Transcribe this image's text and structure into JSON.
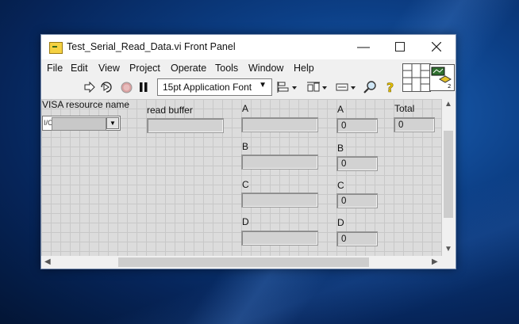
{
  "window": {
    "title": "Test_Serial_Read_Data.vi Front Panel",
    "minimize_glyph": "—",
    "maximize_glyph": "☐",
    "close_glyph": "✕"
  },
  "menu": [
    "File",
    "Edit",
    "View",
    "Project",
    "Operate",
    "Tools",
    "Window",
    "Help"
  ],
  "toolbar": {
    "font_selector": "15pt Application Font"
  },
  "panel": {
    "visa_label": "VISA resource name",
    "visa_value": "",
    "read_buffer_label": "read buffer",
    "read_buffer_value": "",
    "string_indicators": [
      {
        "label": "A",
        "value": ""
      },
      {
        "label": "B",
        "value": ""
      },
      {
        "label": "C",
        "value": ""
      },
      {
        "label": "D",
        "value": ""
      }
    ],
    "numeric_indicators": [
      {
        "label": "A",
        "value": "0"
      },
      {
        "label": "B",
        "value": "0"
      },
      {
        "label": "C",
        "value": "0"
      },
      {
        "label": "D",
        "value": "0"
      }
    ],
    "total_label": "Total",
    "total_value": "0"
  },
  "icons": [
    "app-icon",
    "run-arrow-icon",
    "run-continuously-icon",
    "abort-icon",
    "pause-icon",
    "align-icon",
    "distribute-icon",
    "resize-icon",
    "search-icon",
    "help-icon",
    "connector-pane-icon",
    "vi-icon"
  ]
}
